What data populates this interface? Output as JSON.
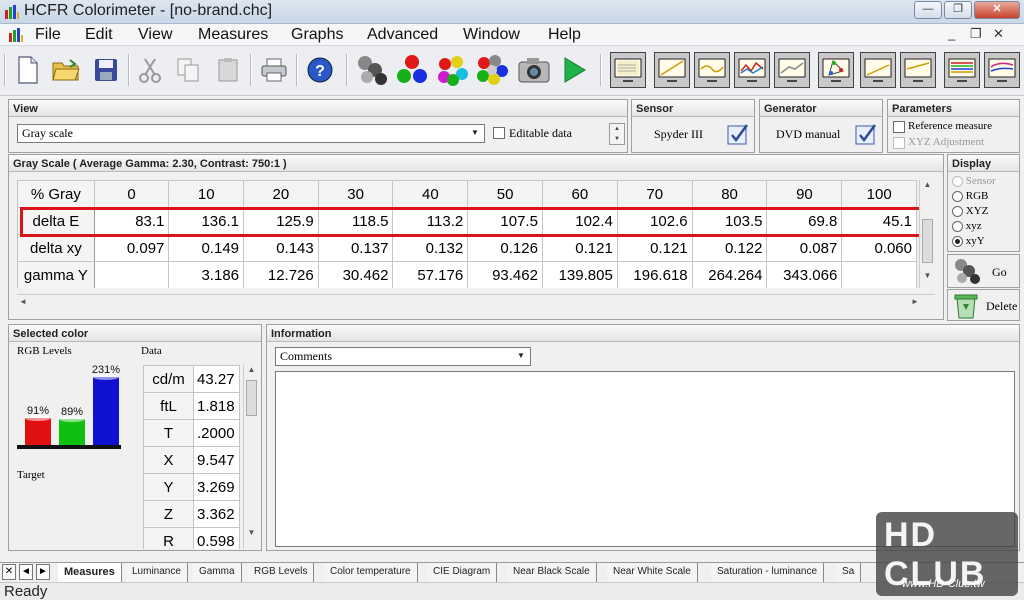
{
  "window": {
    "title": "HCFR Colorimeter - [no-brand.chc]",
    "minimize": "—",
    "maximize": "❐",
    "close": "✕"
  },
  "menu": {
    "items": [
      "File",
      "Edit",
      "View",
      "Measures",
      "Graphs",
      "Advanced",
      "Window",
      "Help"
    ],
    "mdi_min": "_",
    "mdi_restore": "❐",
    "mdi_close": "✕"
  },
  "view_panel": {
    "header": "View",
    "combo_value": "Gray scale",
    "editable_label": "Editable data"
  },
  "sensor_panel": {
    "header": "Sensor",
    "value": "Spyder III"
  },
  "generator_panel": {
    "header": "Generator",
    "value": "DVD manual"
  },
  "parameters_panel": {
    "header": "Parameters",
    "reference_measure": "Reference measure",
    "xyz_adjustment": "XYZ Adjustment"
  },
  "grayscale_panel": {
    "header": "Gray Scale ( Average Gamma: 2.30, Contrast: 750:1 )",
    "columns": [
      "% Gray",
      "0",
      "10",
      "20",
      "30",
      "40",
      "50",
      "60",
      "70",
      "80",
      "90",
      "100"
    ],
    "rows": [
      {
        "label": "delta E",
        "values": [
          "83.1",
          "136.1",
          "125.9",
          "118.5",
          "113.2",
          "107.5",
          "102.4",
          "102.6",
          "103.5",
          "69.8",
          "45.1"
        ]
      },
      {
        "label": "delta xy",
        "values": [
          "0.097",
          "0.149",
          "0.143",
          "0.137",
          "0.132",
          "0.126",
          "0.121",
          "0.121",
          "0.122",
          "0.087",
          "0.060"
        ]
      },
      {
        "label": "gamma Y",
        "values": [
          "",
          "3.186",
          "12.726",
          "30.462",
          "57.176",
          "93.462",
          "139.805",
          "196.618",
          "264.264",
          "343.066",
          ""
        ]
      }
    ],
    "highlight_color": "#d9141b"
  },
  "display_panel": {
    "header": "Display",
    "options": [
      "Sensor",
      "RGB",
      "XYZ",
      "xyz",
      "xyY"
    ],
    "selected": "xyY",
    "go_label": "Go",
    "delete_label": "Delete"
  },
  "selected_color_panel": {
    "header": "Selected color",
    "rgb_levels_label": "RGB Levels",
    "data_label": "Data",
    "target_label": "Target",
    "bars": [
      {
        "name": "R",
        "percent": "91%",
        "value": 91,
        "color": "#e01010"
      },
      {
        "name": "G",
        "percent": "89%",
        "value": 89,
        "color": "#10c010"
      },
      {
        "name": "B",
        "percent": "231%",
        "value": 231,
        "color": "#1010d0"
      }
    ],
    "data_rows": [
      {
        "label": "cd/m",
        "value": "43.27"
      },
      {
        "label": "ftL",
        "value": "1.818"
      },
      {
        "label": "T",
        "value": ".2000"
      },
      {
        "label": "X",
        "value": "9.547"
      },
      {
        "label": "Y",
        "value": "3.269"
      },
      {
        "label": "Z",
        "value": "3.362"
      },
      {
        "label": "R",
        "value": "0.598"
      }
    ]
  },
  "information_panel": {
    "header": "Information",
    "combo_value": "Comments"
  },
  "bottom_tabs": [
    "Measures",
    "Luminance",
    "Gamma",
    "RGB Levels",
    "Color temperature",
    "CIE Diagram",
    "Near Black Scale",
    "Near White Scale",
    "Saturation - luminance",
    "Sa"
  ],
  "active_tab": "Measures",
  "status": "Ready",
  "watermark": {
    "logo": "HD CLUB",
    "url": "www.HD-Club.tw"
  }
}
